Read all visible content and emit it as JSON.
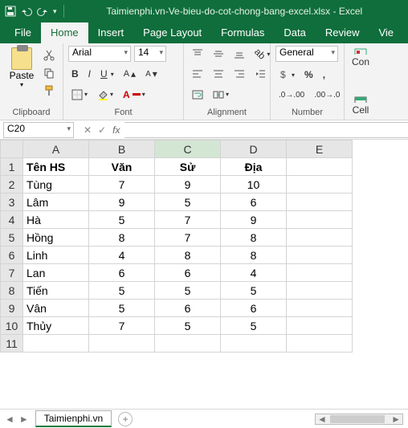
{
  "title": "Taimienphi.vn-Ve-bieu-do-cot-chong-bang-excel.xlsx - Excel",
  "tabs": [
    "File",
    "Home",
    "Insert",
    "Page Layout",
    "Formulas",
    "Data",
    "Review",
    "Vie"
  ],
  "active_tab": "Home",
  "ribbon": {
    "clipboard": {
      "label": "Clipboard",
      "paste": "Paste"
    },
    "font": {
      "label": "Font",
      "name": "Arial",
      "size": "14"
    },
    "alignment": {
      "label": "Alignment"
    },
    "number": {
      "label": "Number",
      "format": "General"
    },
    "cells": {
      "cond": "Con",
      "cell": "Cell"
    }
  },
  "namebox": "C20",
  "fx": "fx",
  "columns": [
    "A",
    "B",
    "C",
    "D",
    "E"
  ],
  "selected_col": "C",
  "chart_data": {
    "type": "table",
    "headers": [
      "Tên HS",
      "Văn",
      "Sử",
      "Địa"
    ],
    "rows": [
      [
        "Tùng",
        "7",
        "9",
        "10"
      ],
      [
        "Lâm",
        "9",
        "5",
        "6"
      ],
      [
        "Hà",
        "5",
        "7",
        "9"
      ],
      [
        "Hồng",
        "8",
        "7",
        "8"
      ],
      [
        "Linh",
        "4",
        "8",
        "8"
      ],
      [
        "Lan",
        "6",
        "6",
        "4"
      ],
      [
        "Tiến",
        "5",
        "5",
        "5"
      ],
      [
        "Vân",
        "5",
        "6",
        "6"
      ],
      [
        "Thủy",
        "7",
        "5",
        "5"
      ]
    ]
  },
  "sheet": {
    "name": "Taimienphi.vn"
  }
}
